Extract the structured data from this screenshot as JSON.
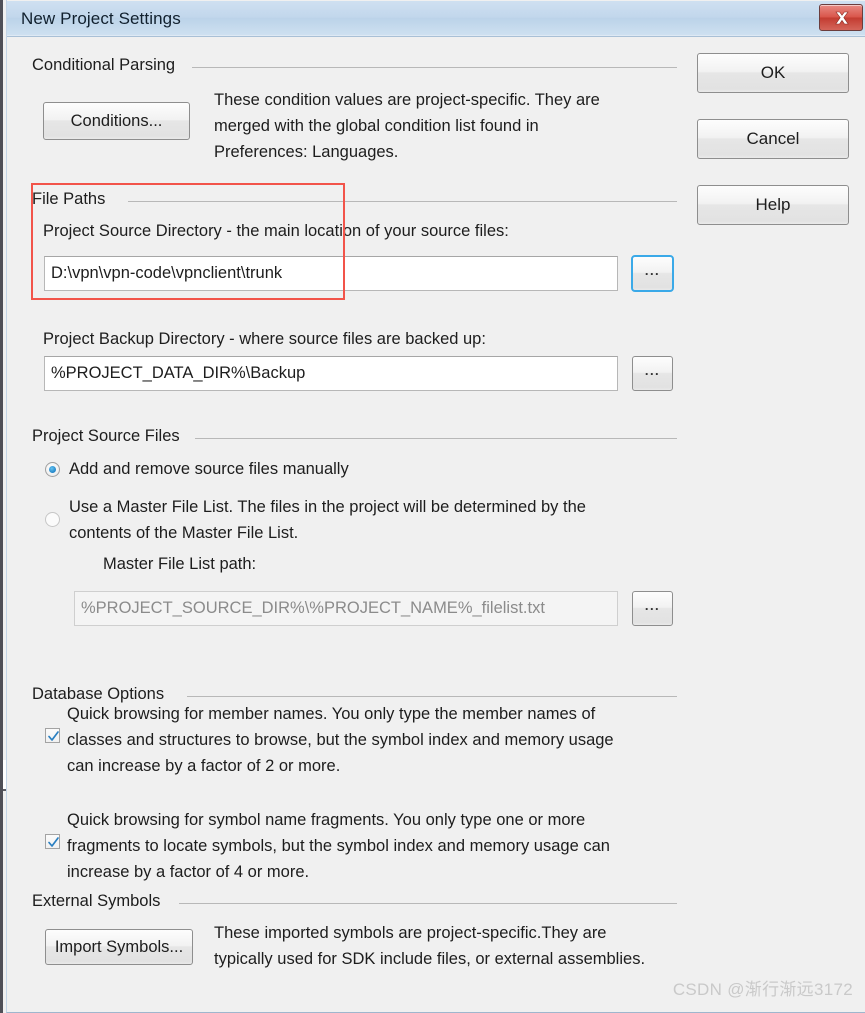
{
  "window": {
    "title": "New Project Settings",
    "close_label": "Close"
  },
  "buttons": {
    "ok": "OK",
    "cancel": "Cancel",
    "help": "Help",
    "conditions": "Conditions...",
    "import_symbols": "Import Symbols...",
    "browse_ellipsis": "..."
  },
  "groups": {
    "conditional_parsing": {
      "label": "Conditional Parsing",
      "description": "These condition values are project-specific.  They are\nmerged with the global condition list found in\nPreferences: Languages."
    },
    "file_paths": {
      "label": "File Paths",
      "source_dir_label": "Project Source Directory - the main location of your source files:",
      "source_dir_value": "D:\\vpn\\vpn-code\\vpnclient\\trunk",
      "backup_dir_label": "Project Backup Directory - where source files are backed up:",
      "backup_dir_value": "%PROJECT_DATA_DIR%\\Backup"
    },
    "project_source_files": {
      "label": "Project Source Files",
      "radio_manual": "Add and remove source files manually",
      "radio_manual_checked": true,
      "radio_master": "Use a Master File List. The files in the project will be determined by the\ncontents of the Master File List.",
      "radio_master_checked": false,
      "master_path_label": "Master File List path:",
      "master_path_value": "%PROJECT_SOURCE_DIR%\\%PROJECT_NAME%_filelist.txt",
      "master_path_disabled": true
    },
    "database_options": {
      "label": "Database Options",
      "option1": "Quick browsing for member names.  You only type the member names of\nclasses and structures to browse, but the symbol index and memory usage\ncan increase by a factor of 2 or more.",
      "option1_checked": true,
      "option2": "Quick browsing for symbol name fragments.  You only type one or more\nfragments to locate symbols, but the symbol index and memory usage can\nincrease by a factor of 4 or more.",
      "option2_checked": true
    },
    "external_symbols": {
      "label": "External Symbols",
      "description": "These imported symbols are project-specific.They are\ntypically used for SDK include files, or external assemblies."
    }
  },
  "annotation": {
    "color": "#f2544a",
    "target": "file-paths-source-directory"
  },
  "watermark": {
    "text": "CSDN @渐行渐远3172"
  }
}
